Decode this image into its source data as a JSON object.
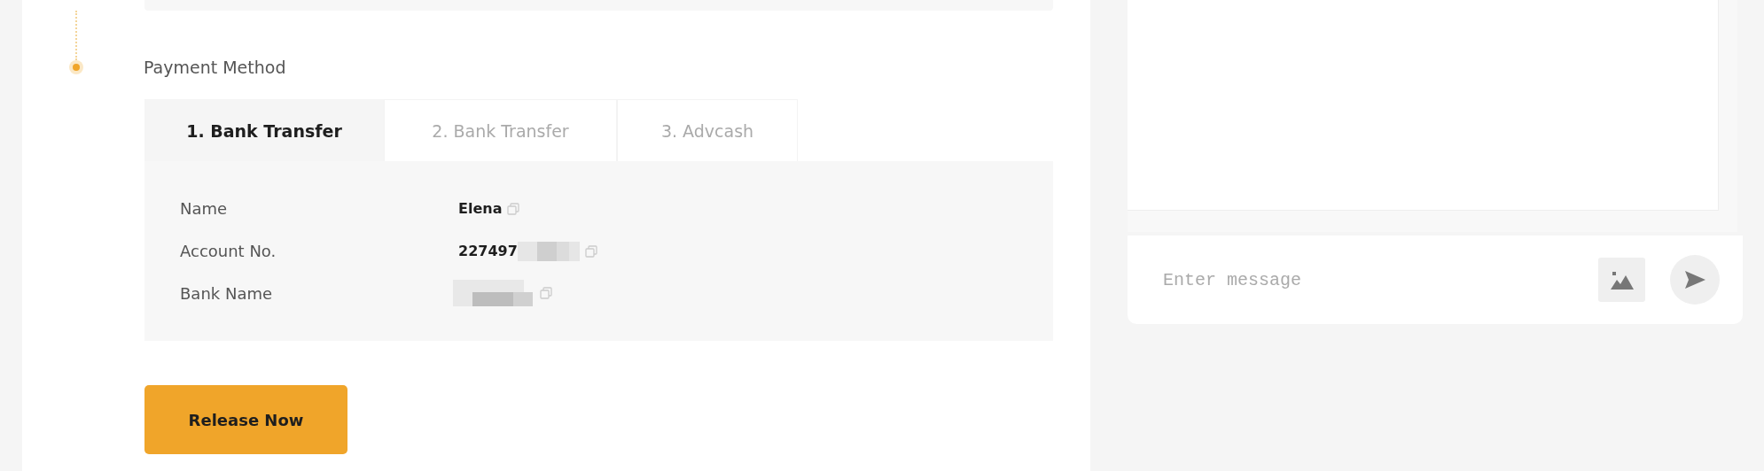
{
  "payment_method": {
    "label": "Payment Method",
    "tabs": [
      {
        "label": "1. Bank Transfer",
        "selected": true
      },
      {
        "label": "2. Bank Transfer",
        "selected": false
      },
      {
        "label": "3. Advcash",
        "selected": false
      }
    ],
    "details": [
      {
        "label": "Name",
        "value": "Elena",
        "redacted": false
      },
      {
        "label": "Account No.",
        "value": "227497",
        "redacted": true
      },
      {
        "label": "Bank Name",
        "redacted": true
      }
    ]
  },
  "release_button": "Release Now",
  "chat": {
    "placeholder": "Enter message"
  }
}
